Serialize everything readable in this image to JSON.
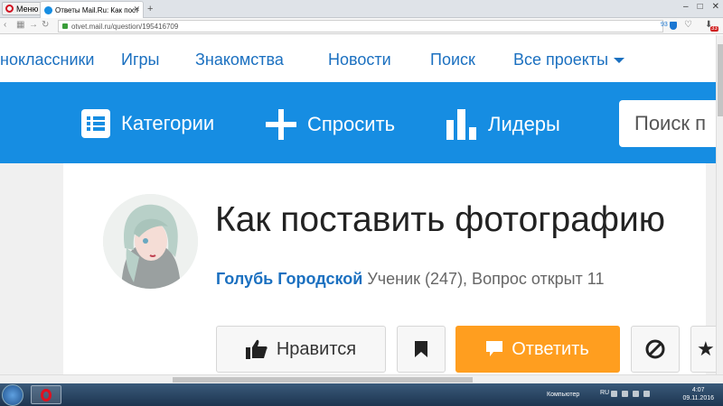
{
  "browser": {
    "menu_label": "Меню",
    "tab_title": "Ответы Mail.Ru: Как пост",
    "url": "otvet.mail.ru/question/195416709",
    "badge_count": "93",
    "downloads_badge": "33"
  },
  "topnav": {
    "items": [
      "ноклассники",
      "Игры",
      "Знакомства",
      "Новости",
      "Поиск",
      "Все проекты"
    ]
  },
  "bluebar": {
    "categories": "Категории",
    "ask": "Спросить",
    "leaders": "Лидеры",
    "search_placeholder": "Поиск п"
  },
  "question": {
    "title": "Как поставить фотографию",
    "author": "Голубь Городской",
    "meta": " Ученик (247), Вопрос открыт 11"
  },
  "actions": {
    "like": "Нравится",
    "answer": "Ответить"
  },
  "taskbar": {
    "tray_label": "Компьютер",
    "lang": "RU",
    "time": "4:07",
    "date": "09.11.2016"
  },
  "colors": {
    "blue_bar": "#168de2",
    "link": "#1b70c0",
    "answer_button": "#ff9e1f"
  }
}
